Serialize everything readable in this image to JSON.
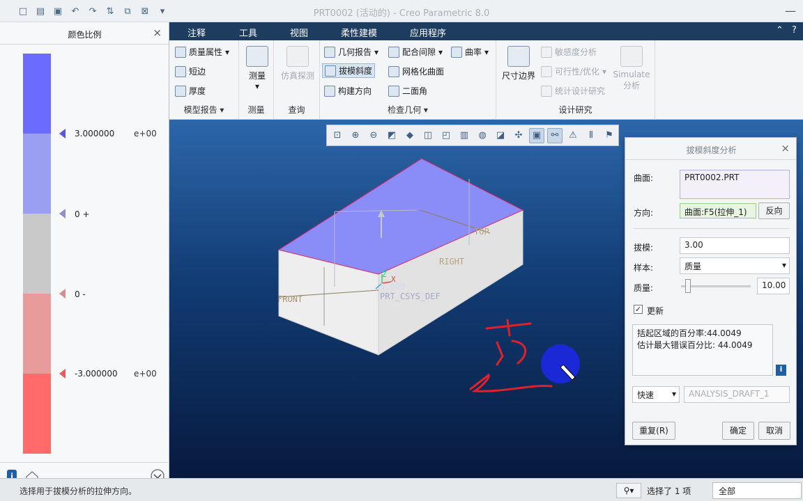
{
  "window": {
    "title": "PRT0002 (活动的) - Creo Parametric 8.0"
  },
  "ribbon": {
    "tabs": [
      "注释",
      "工具",
      "视图",
      "柔性建模",
      "应用程序"
    ],
    "groups": {
      "model_report": {
        "items": [
          "质量属性",
          "短边",
          "厚度"
        ],
        "label": "模型报告"
      },
      "measure": {
        "button": "测量",
        "label": "测量"
      },
      "query": {
        "button": "仿真探测",
        "label": "查询"
      },
      "inspect_geometry": {
        "items": [
          "几何报告",
          "配合间隙",
          "曲率",
          "拔模斜度",
          "网格化曲面",
          "构建方向",
          "二面角"
        ],
        "label": "检查几何"
      },
      "design_study": {
        "dim_boundary": "尺寸边界",
        "items": [
          "敏感度分析",
          "可行性/优化",
          "统计设计研究"
        ],
        "simulate": [
          "Simulate",
          "分析"
        ],
        "label": "设计研究"
      }
    }
  },
  "color_scale": {
    "title": "颜色比例",
    "colors": [
      "#6b6bff",
      "#9b9ff2",
      "#c9c9c9",
      "#e89b9b",
      "#ff6b6b"
    ],
    "markers": [
      {
        "value": "3.000000",
        "exp": "e+00",
        "color": "#5a5ad6"
      },
      {
        "value": "0 +",
        "exp": "",
        "color": "#8e90c6"
      },
      {
        "value": "0 -",
        "exp": "",
        "color": "#d38d8d"
      },
      {
        "value": "-3.000000",
        "exp": "e+00",
        "color": "#e06060"
      }
    ]
  },
  "viewport": {
    "labels": {
      "top": "TOP",
      "right": "RIGHT",
      "front": "FRONT",
      "csys": "PRT_CSYS_DEF",
      "draft": "3.000",
      "z": "Z",
      "x": "X"
    },
    "annotation_color": "#e0202a"
  },
  "dialog": {
    "title": "拔模斜度分析",
    "surface_label": "曲面:",
    "surface_value": "PRT0002.PRT",
    "direction_label": "方向:",
    "direction_value": "曲面:F5(拉伸_1)",
    "reverse_button": "反向",
    "draft_label": "拔模:",
    "draft_value": "3.00",
    "sample_label": "样本:",
    "sample_value": "质量",
    "quality_label": "质量:",
    "quality_value": "10.00",
    "quality_slider": 0.1,
    "update_label": "更新",
    "update_checked": true,
    "results": [
      "括起区域的百分率:44.0049",
      "估计最大错误百分比: 44.0049"
    ],
    "mode_value": "快速",
    "feature_name": "ANALYSIS_DRAFT_1",
    "repeat_button": "重复(R)",
    "ok_button": "确定",
    "cancel_button": "取消"
  },
  "status": {
    "message": "选择用于拔模分析的拉伸方向。",
    "selected": "选择了 1 项",
    "filter": "全部"
  }
}
